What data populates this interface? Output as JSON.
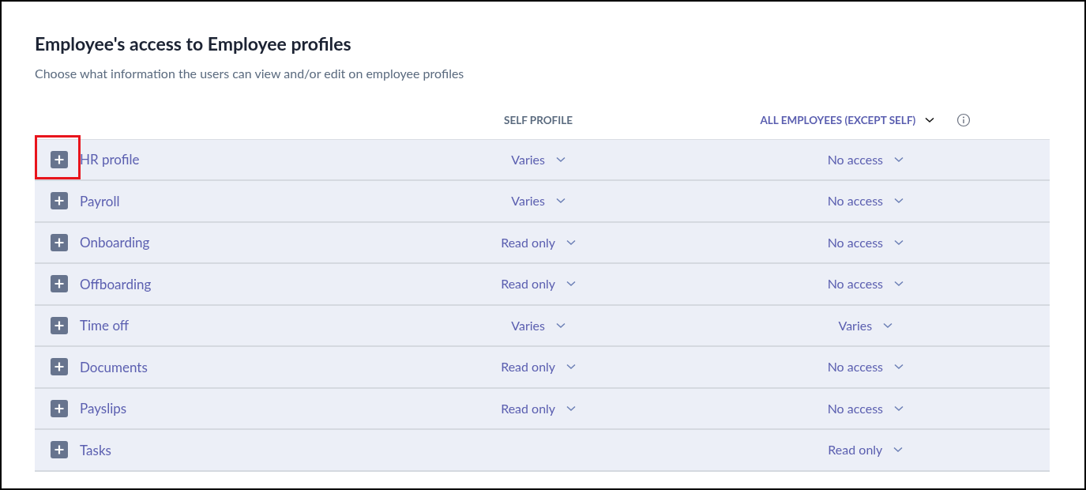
{
  "title": "Employee's access to Employee profiles",
  "subtitle": "Choose what information the users can view and/or edit on employee profiles",
  "columns": [
    {
      "label": "SELF PROFILE",
      "kind": "plain"
    },
    {
      "label": "ALL EMPLOYEES (EXCEPT SELF)",
      "kind": "dropdown"
    }
  ],
  "rows": [
    {
      "label": "HR profile",
      "highlighted": true,
      "self": "Varies",
      "all": "No access"
    },
    {
      "label": "Payroll",
      "highlighted": false,
      "self": "Varies",
      "all": "No access"
    },
    {
      "label": "Onboarding",
      "highlighted": false,
      "self": "Read only",
      "all": "No access"
    },
    {
      "label": "Offboarding",
      "highlighted": false,
      "self": "Read only",
      "all": "No access"
    },
    {
      "label": "Time off",
      "highlighted": false,
      "self": "Varies",
      "all": "Varies"
    },
    {
      "label": "Documents",
      "highlighted": false,
      "self": "Read only",
      "all": "No access"
    },
    {
      "label": "Payslips",
      "highlighted": false,
      "self": "Read only",
      "all": "No access"
    },
    {
      "label": "Tasks",
      "highlighted": false,
      "all": "Read only"
    }
  ]
}
